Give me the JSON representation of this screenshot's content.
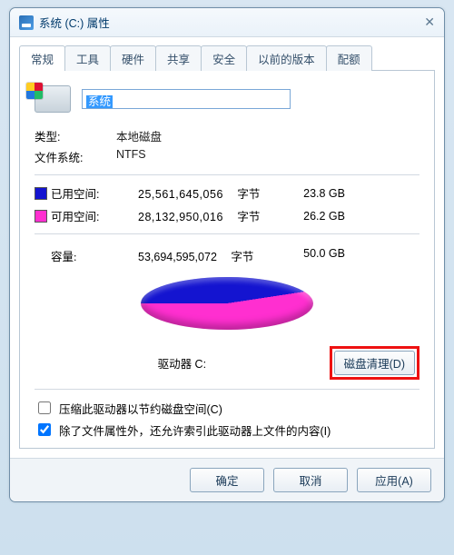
{
  "window": {
    "title": "系统 (C:) 属性"
  },
  "tabs": [
    "常规",
    "工具",
    "硬件",
    "共享",
    "安全",
    "以前的版本",
    "配额"
  ],
  "activeTab": 0,
  "drive": {
    "name": "系统",
    "type_label": "类型:",
    "type_value": "本地磁盘",
    "fs_label": "文件系统:",
    "fs_value": "NTFS"
  },
  "space": {
    "used_label": "已用空间:",
    "used_bytes": "25,561,645,056",
    "used_bytes_unit": "字节",
    "used_size": "23.8 GB",
    "free_label": "可用空间:",
    "free_bytes": "28,132,950,016",
    "free_bytes_unit": "字节",
    "free_size": "26.2 GB",
    "cap_label": "容量:",
    "cap_bytes": "53,694,595,072",
    "cap_bytes_unit": "字节",
    "cap_size": "50.0 GB"
  },
  "pie_label": "驱动器 C:",
  "cleanup_button": "磁盘清理(D)",
  "checks": {
    "compress": {
      "label": "压缩此驱动器以节约磁盘空间(C)",
      "checked": false
    },
    "index": {
      "label": "除了文件属性外，还允许索引此驱动器上文件的内容(I)",
      "checked": true
    }
  },
  "buttons": {
    "ok": "确定",
    "cancel": "取消",
    "apply": "应用(A)"
  },
  "colors": {
    "used": "#1414d0",
    "free": "#ff2fd0"
  },
  "chart_data": {
    "type": "pie",
    "title": "驱动器 C:",
    "series": [
      {
        "name": "已用空间",
        "value": 25561645056,
        "display": "23.8 GB",
        "color": "#1414d0"
      },
      {
        "name": "可用空间",
        "value": 28132950016,
        "display": "26.2 GB",
        "color": "#ff2fd0"
      }
    ],
    "total": 53694595072,
    "total_display": "50.0 GB"
  }
}
